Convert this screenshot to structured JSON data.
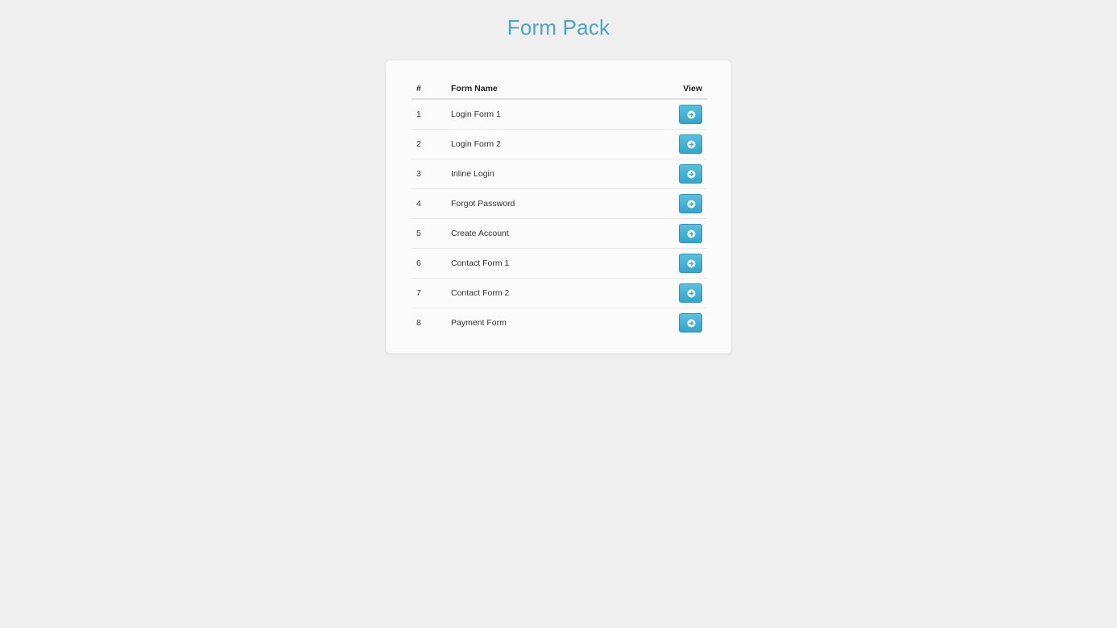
{
  "page": {
    "title": "Form Pack"
  },
  "table": {
    "headers": {
      "num": "#",
      "name": "Form Name",
      "view": "View"
    },
    "rows": [
      {
        "num": "1",
        "name": "Login Form 1"
      },
      {
        "num": "2",
        "name": "Login Form 2"
      },
      {
        "num": "3",
        "name": "Inline Login"
      },
      {
        "num": "4",
        "name": "Forgot Password"
      },
      {
        "num": "5",
        "name": "Create Account"
      },
      {
        "num": "6",
        "name": "Contact Form 1"
      },
      {
        "num": "7",
        "name": "Contact Form 2"
      },
      {
        "num": "8",
        "name": "Payment Form"
      }
    ],
    "view_icon": "arrow-circle-right-icon"
  },
  "colors": {
    "title": "#4aa6c5",
    "button": "#3badd2",
    "background": "#efefef"
  }
}
